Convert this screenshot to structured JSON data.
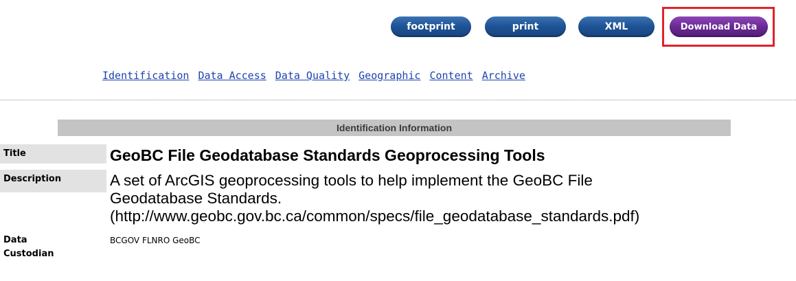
{
  "toolbar": {
    "buttons": [
      {
        "label": "footprint"
      },
      {
        "label": "print"
      },
      {
        "label": "XML"
      },
      {
        "label": "Download Data"
      }
    ],
    "highlight_color": "#e0222a"
  },
  "nav": {
    "links": [
      "Identification",
      "Data Access",
      "Data Quality",
      "Geographic",
      "Content",
      "Archive"
    ]
  },
  "section": {
    "header": "Identification Information"
  },
  "fields": {
    "title_label": "Title",
    "title_value": "GeoBC File Geodatabase Standards Geoprocessing Tools",
    "description_label": "Description",
    "description_lines": [
      "A set of ArcGIS geoprocessing tools to help implement the GeoBC File",
      "Geodatabase Standards.",
      "(http://www.geobc.gov.bc.ca/common/specs/file_geodatabase_standards.pdf)"
    ],
    "custodian_label_lines": [
      "Data",
      "Custodian"
    ],
    "custodian_value": "BCGOV FLNRO GeoBC"
  },
  "colors": {
    "button_blue": "#1f5497",
    "button_purple": "#6a2994",
    "link_blue": "#1c43b0",
    "header_gray": "#c4c4c4",
    "label_gray": "#e2e2e2"
  }
}
